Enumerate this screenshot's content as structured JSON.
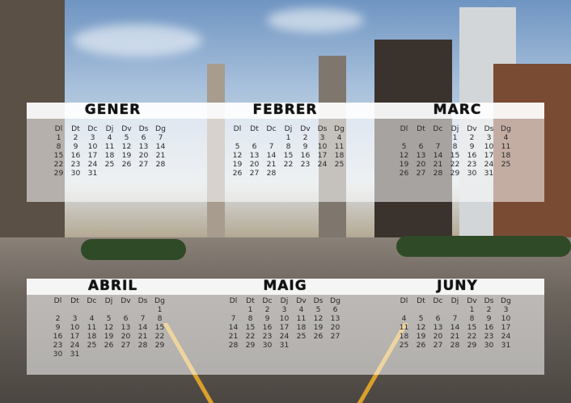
{
  "months_top": [
    {
      "name": "GENER",
      "headers": [
        "Dl",
        "Dt",
        "Dc",
        "Dj",
        "Dv",
        "Ds",
        "Dg"
      ],
      "weeks": [
        [
          "1",
          "2",
          "3",
          "4",
          "5",
          "6",
          "7"
        ],
        [
          "8",
          "9",
          "10",
          "11",
          "12",
          "13",
          "14"
        ],
        [
          "15",
          "16",
          "17",
          "18",
          "19",
          "20",
          "21"
        ],
        [
          "22",
          "23",
          "24",
          "25",
          "26",
          "27",
          "28"
        ],
        [
          "29",
          "30",
          "31",
          "",
          "",
          "",
          ""
        ]
      ]
    },
    {
      "name": "FEBRER",
      "headers": [
        "Dl",
        "Dt",
        "Dc",
        "Dj",
        "Dv",
        "Ds",
        "Dg"
      ],
      "weeks": [
        [
          "",
          "",
          "",
          "1",
          "2",
          "3",
          "4"
        ],
        [
          "5",
          "6",
          "7",
          "8",
          "9",
          "10",
          "11"
        ],
        [
          "12",
          "13",
          "14",
          "15",
          "16",
          "17",
          "18"
        ],
        [
          "19",
          "20",
          "21",
          "22",
          "23",
          "24",
          "25"
        ],
        [
          "26",
          "27",
          "28",
          "",
          "",
          "",
          ""
        ]
      ]
    },
    {
      "name": "MARC",
      "headers": [
        "Dl",
        "Dt",
        "Dc",
        "Dj",
        "Dv",
        "Ds",
        "Dg"
      ],
      "weeks": [
        [
          "",
          "",
          "",
          "1",
          "2",
          "3",
          "4"
        ],
        [
          "5",
          "6",
          "7",
          "8",
          "9",
          "10",
          "11"
        ],
        [
          "12",
          "13",
          "14",
          "15",
          "16",
          "17",
          "18"
        ],
        [
          "19",
          "20",
          "21",
          "22",
          "23",
          "24",
          "25"
        ],
        [
          "26",
          "27",
          "28",
          "29",
          "30",
          "31",
          ""
        ]
      ]
    }
  ],
  "months_bottom": [
    {
      "name": "ABRIL",
      "headers": [
        "Dl",
        "Dt",
        "Dc",
        "Dj",
        "Dv",
        "Ds",
        "Dg"
      ],
      "weeks": [
        [
          "",
          "",
          "",
          "",
          "",
          "",
          "1"
        ],
        [
          "2",
          "3",
          "4",
          "5",
          "6",
          "7",
          "8"
        ],
        [
          "9",
          "10",
          "11",
          "12",
          "13",
          "14",
          "15"
        ],
        [
          "16",
          "17",
          "18",
          "19",
          "20",
          "21",
          "22"
        ],
        [
          "23",
          "24",
          "25",
          "26",
          "27",
          "28",
          "29"
        ],
        [
          "30",
          "31",
          "",
          "",
          "",
          "",
          ""
        ]
      ]
    },
    {
      "name": "MAIG",
      "headers": [
        "Dl",
        "Dt",
        "Dc",
        "Dj",
        "Dv",
        "Ds",
        "Dg"
      ],
      "weeks": [
        [
          "",
          "1",
          "2",
          "3",
          "4",
          "5",
          "6"
        ],
        [
          "7",
          "8",
          "9",
          "10",
          "11",
          "12",
          "13"
        ],
        [
          "14",
          "15",
          "16",
          "17",
          "18",
          "19",
          "20"
        ],
        [
          "21",
          "22",
          "23",
          "24",
          "25",
          "26",
          "27"
        ],
        [
          "28",
          "29",
          "30",
          "31",
          "",
          "",
          ""
        ]
      ]
    },
    {
      "name": "JUNY",
      "headers": [
        "Dl",
        "Dt",
        "Dc",
        "Dj",
        "Dv",
        "Ds",
        "Dg"
      ],
      "weeks": [
        [
          "",
          "",
          "",
          "",
          "1",
          "2",
          "3"
        ],
        [
          "4",
          "5",
          "6",
          "7",
          "8",
          "9",
          "10"
        ],
        [
          "11",
          "12",
          "13",
          "14",
          "15",
          "16",
          "17"
        ],
        [
          "18",
          "19",
          "20",
          "21",
          "22",
          "23",
          "24"
        ],
        [
          "25",
          "26",
          "27",
          "28",
          "29",
          "30",
          "31"
        ]
      ]
    }
  ]
}
